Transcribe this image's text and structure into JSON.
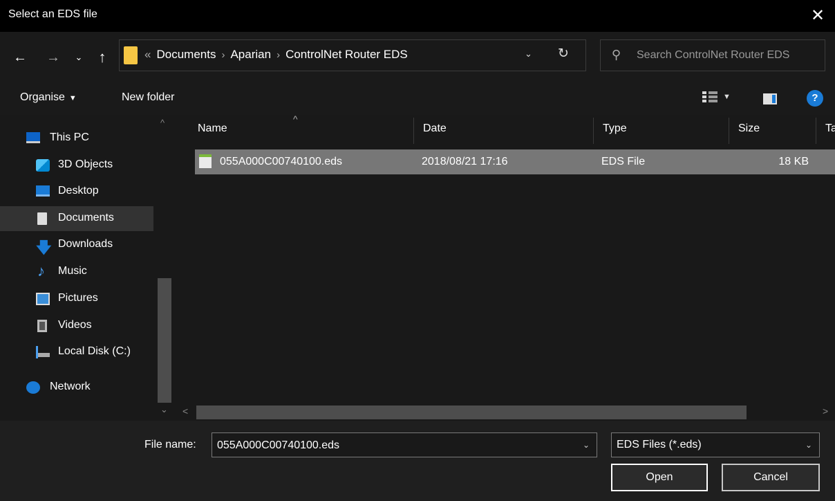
{
  "window": {
    "title": "Select an EDS file",
    "close_glyph": "✕"
  },
  "nav": {
    "back_glyph": "←",
    "forward_glyph": "→",
    "recent_glyph": "⌄",
    "up_glyph": "↑",
    "overflow_glyph": "«",
    "separator": "›",
    "breadcrumb": [
      "Documents",
      "Aparian",
      "ControlNet Router EDS"
    ],
    "dropdown_glyph": "⌄",
    "refresh_glyph": "↻"
  },
  "search": {
    "placeholder": "Search ControlNet Router EDS",
    "icon": "search-icon"
  },
  "toolbar": {
    "organise_label": "Organise",
    "organise_caret": "▼",
    "new_folder_label": "New folder",
    "view_caret": "▼",
    "help_glyph": "?"
  },
  "sidebar": {
    "items": [
      {
        "label": "This PC",
        "icon": "computer-icon"
      },
      {
        "label": "3D Objects",
        "icon": "cube-icon"
      },
      {
        "label": "Desktop",
        "icon": "desktop-icon"
      },
      {
        "label": "Documents",
        "icon": "document-icon",
        "selected": true
      },
      {
        "label": "Downloads",
        "icon": "download-arrow-icon"
      },
      {
        "label": "Music",
        "icon": "music-note-icon"
      },
      {
        "label": "Pictures",
        "icon": "picture-icon"
      },
      {
        "label": "Videos",
        "icon": "film-icon"
      },
      {
        "label": "Local Disk (C:)",
        "icon": "drive-icon"
      },
      {
        "label": "Network",
        "icon": "network-icon"
      }
    ],
    "scroll_up": "^",
    "scroll_down": "⌄"
  },
  "file_list": {
    "columns": [
      "Name",
      "Date",
      "Type",
      "Size",
      "Ta"
    ],
    "sort_glyph": "^",
    "rows": [
      {
        "name": "055A000C00740100.eds",
        "date": "2018/08/21 17:16",
        "type": "EDS File",
        "size": "18 KB"
      }
    ],
    "scroll_left": "<",
    "scroll_right": ">"
  },
  "bottom": {
    "file_name_label": "File name:",
    "file_name_value": "055A000C00740100.eds",
    "file_name_dropdown": "⌄",
    "filter_value": "EDS Files (*.eds)",
    "filter_dropdown": "⌄",
    "open_label": "Open",
    "cancel_label": "Cancel"
  },
  "colors": {
    "accent": "#1a7bd6",
    "selection": "#777777",
    "folder": "#f6c644"
  }
}
